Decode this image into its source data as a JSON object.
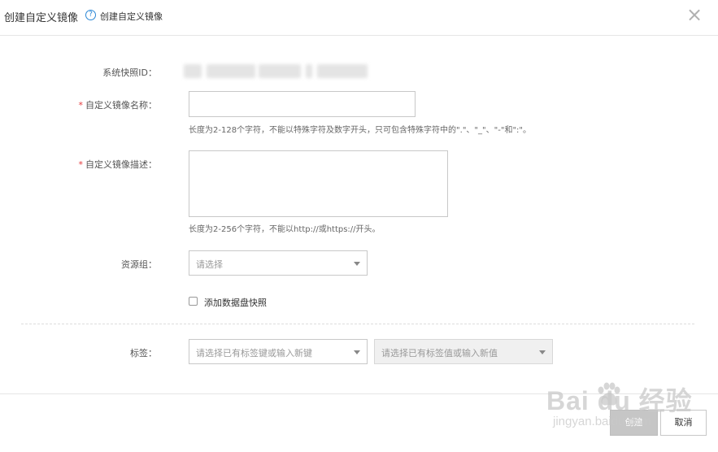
{
  "header": {
    "title": "创建自定义镜像",
    "help_icon_char": "?",
    "help_text": "创建自定义镜像",
    "close_char": "×"
  },
  "form": {
    "snapshot_id_label": "系统快照ID：",
    "name_label": "自定义镜像名称：",
    "name_required": "*",
    "name_value": "",
    "name_hint": "长度为2-128个字符，不能以特殊字符及数字开头，只可包含特殊字符中的\".\"、\"_\"、\"-\"和\":\"。",
    "desc_label": "自定义镜像描述：",
    "desc_required": "*",
    "desc_value": "",
    "desc_hint": "长度为2-256个字符，不能以http://或https://开头。",
    "resource_group_label": "资源组：",
    "resource_group_placeholder": "请选择",
    "add_disk_snapshot_label": "添加数据盘快照",
    "add_disk_snapshot_checked": false,
    "tags_label": "标签：",
    "tag_key_placeholder": "请选择已有标签键或输入新键",
    "tag_value_placeholder": "请选择已有标签值或输入新值"
  },
  "footer": {
    "create_label": "创建",
    "cancel_label": "取消"
  },
  "watermark": {
    "main": "Bai du 经验",
    "sub": "jingyan.baidu.com"
  }
}
